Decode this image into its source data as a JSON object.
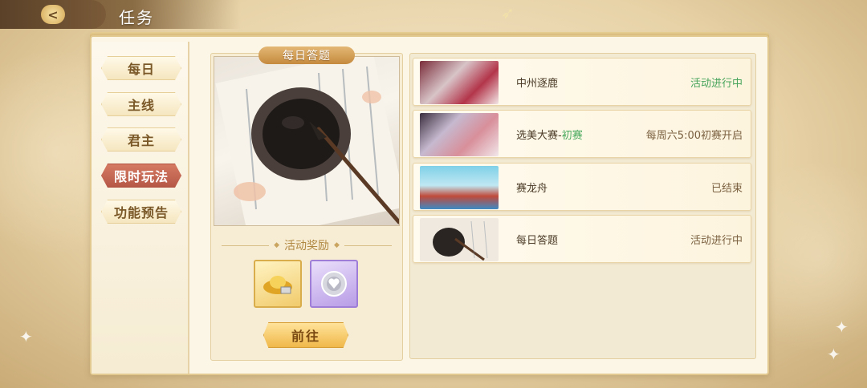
{
  "header": {
    "back_icon": "back-arrow-icon",
    "title": "任务"
  },
  "sidebar": {
    "tabs": [
      {
        "label": "每日",
        "active": false
      },
      {
        "label": "主线",
        "active": false
      },
      {
        "label": "君主",
        "active": false
      },
      {
        "label": "限时玩法",
        "active": true
      },
      {
        "label": "功能预告",
        "active": false
      }
    ]
  },
  "detail": {
    "banner_title": "每日答题",
    "reward_header": "活动奖励",
    "rewards": [
      {
        "icon": "gold-ingot-icon"
      },
      {
        "icon": "silver-coin-icon"
      }
    ],
    "go_button": "前往"
  },
  "activities": [
    {
      "name": "中州逐鹿",
      "name_sub": "",
      "status": "活动进行中",
      "status_color": "#45a35a"
    },
    {
      "name": "选美大赛-",
      "name_sub": "初赛",
      "status": "每周六5:00初赛开启",
      "status_color": "#7a6040"
    },
    {
      "name": "赛龙舟",
      "name_sub": "",
      "status": "已结束",
      "status_color": "#7a6040"
    },
    {
      "name": "每日答题",
      "name_sub": "",
      "status": "活动进行中",
      "status_color": "#7a6040"
    }
  ],
  "colors": {
    "active_tab": "#b65846",
    "accent_gold": "#f0b84a",
    "status_green": "#45a35a"
  }
}
